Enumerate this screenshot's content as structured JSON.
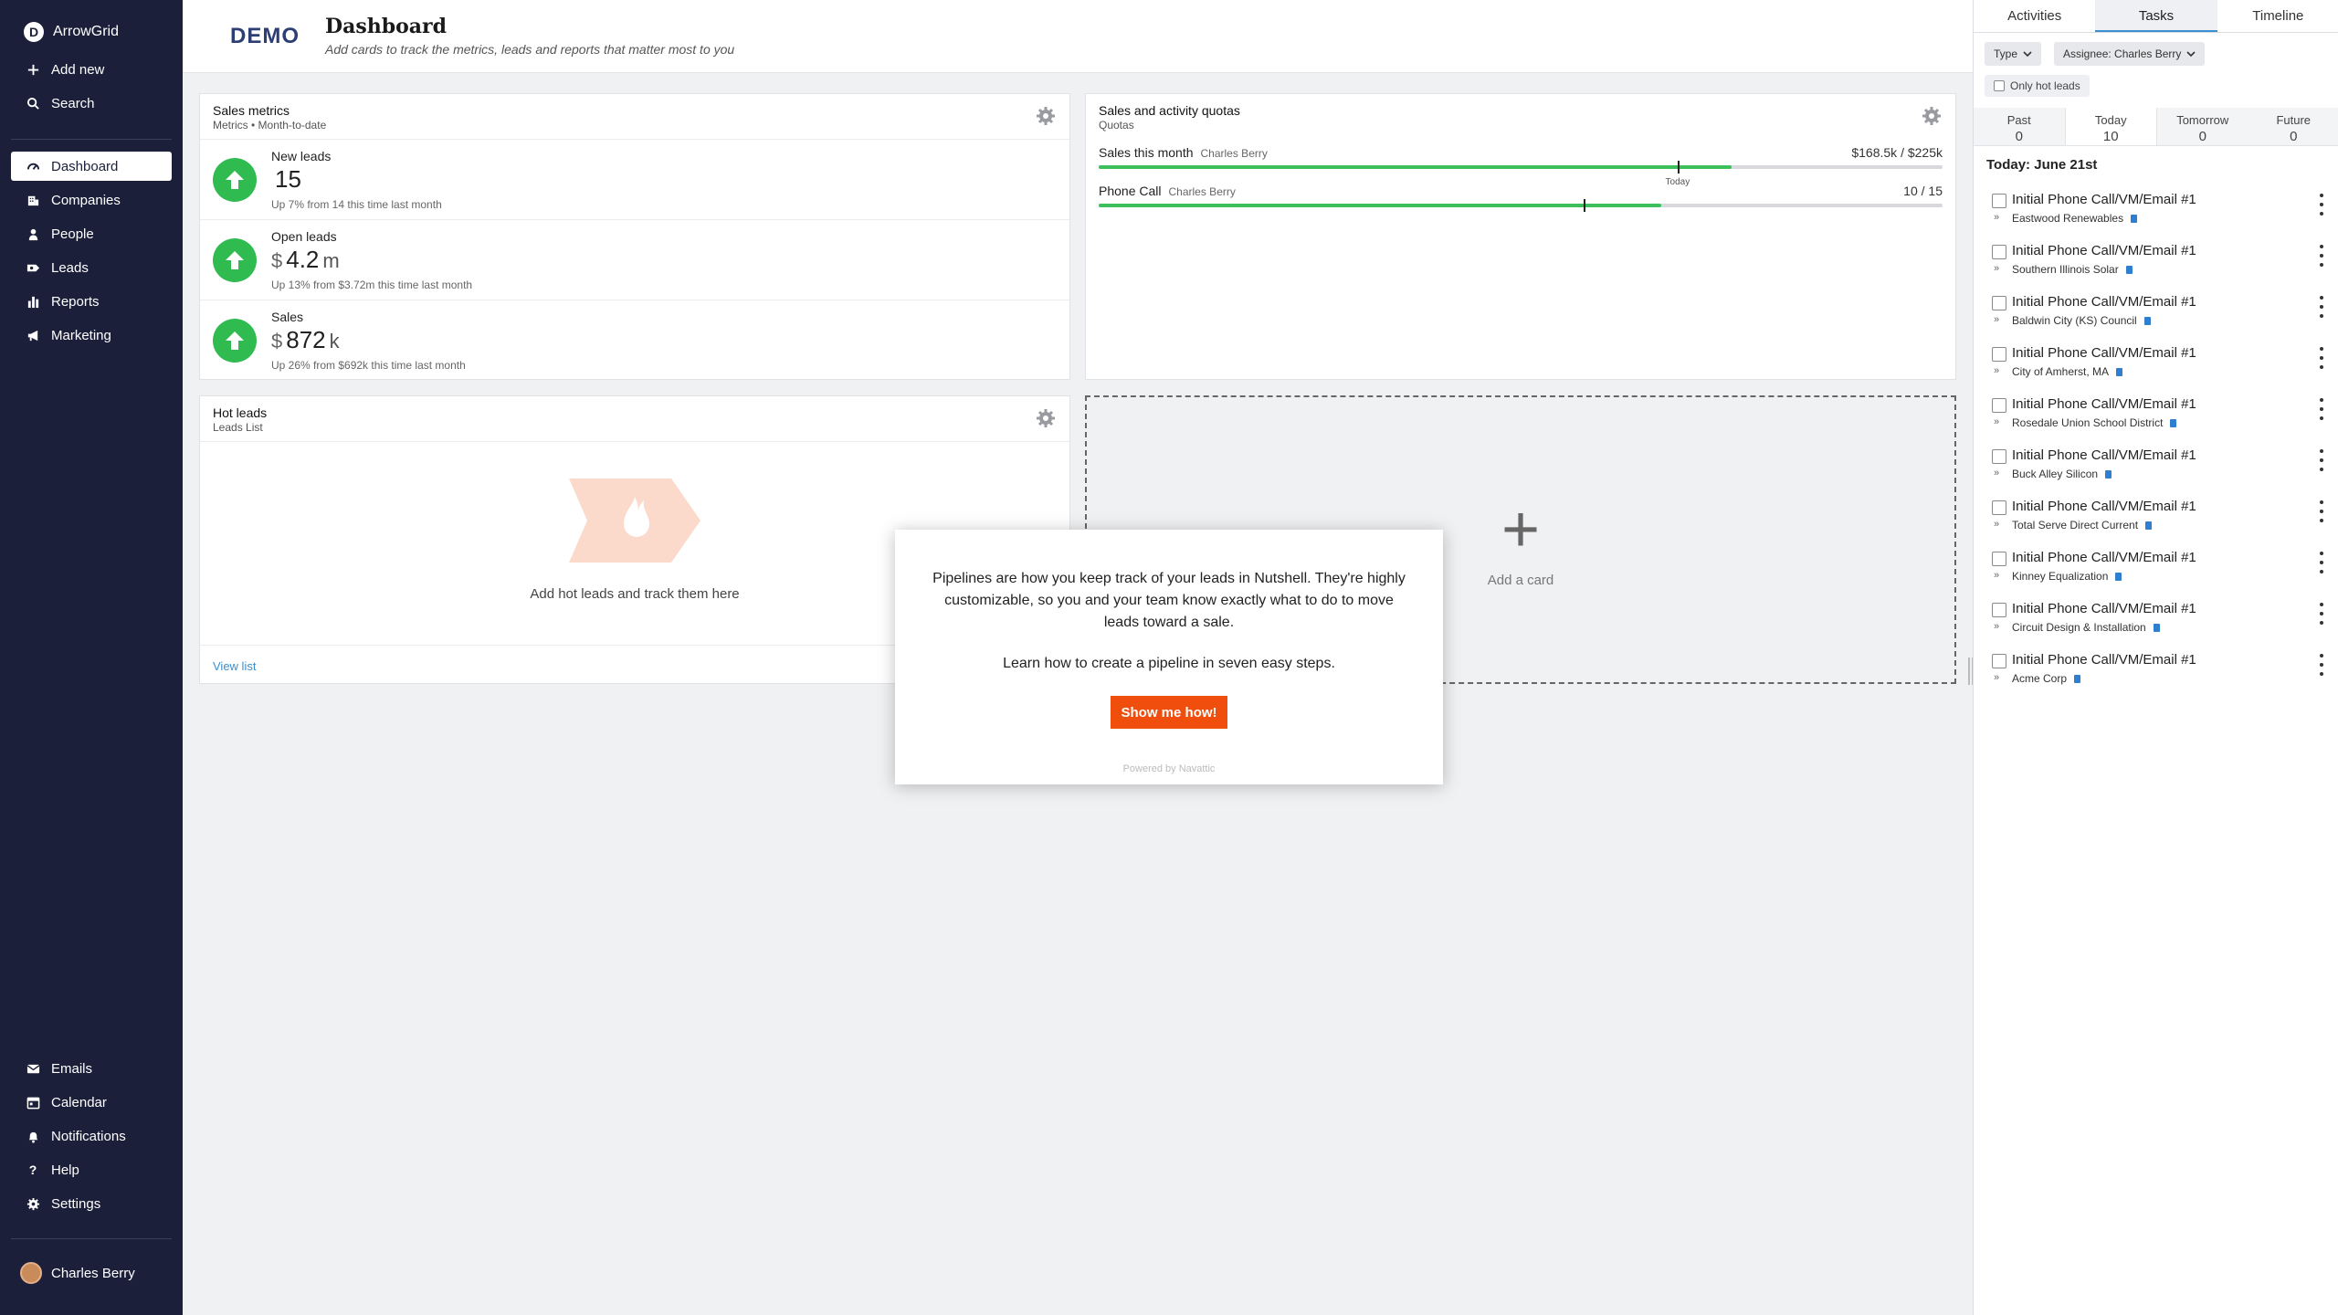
{
  "app": {
    "name": "ArrowGrid",
    "logo_letter": "D"
  },
  "sidebar": {
    "top_items": [
      {
        "label": "Add new",
        "icon": "plus-icon"
      },
      {
        "label": "Search",
        "icon": "search-icon"
      }
    ],
    "main_items": [
      {
        "label": "Dashboard",
        "icon": "dashboard-icon",
        "active": true
      },
      {
        "label": "Companies",
        "icon": "building-icon"
      },
      {
        "label": "People",
        "icon": "person-icon"
      },
      {
        "label": "Leads",
        "icon": "lead-icon"
      },
      {
        "label": "Reports",
        "icon": "bar-chart-icon"
      },
      {
        "label": "Marketing",
        "icon": "megaphone-icon"
      }
    ],
    "bottom_items": [
      {
        "label": "Emails",
        "icon": "mail-icon"
      },
      {
        "label": "Calendar",
        "icon": "calendar-icon"
      },
      {
        "label": "Notifications",
        "icon": "bell-icon"
      },
      {
        "label": "Help",
        "icon": "question-icon"
      },
      {
        "label": "Settings",
        "icon": "gear-icon"
      }
    ],
    "user": "Charles Berry"
  },
  "header": {
    "demo": "DEMO",
    "title": "Dashboard",
    "subtitle": "Add cards to track the metrics, leads and reports that matter most to you"
  },
  "sales_metrics": {
    "title": "Sales metrics",
    "subtitle": "Metrics • Month-to-date",
    "metrics": [
      {
        "label": "New leads",
        "currency": "",
        "value": "15",
        "unit": "",
        "note": "Up 7% from 14 this time last month"
      },
      {
        "label": "Open leads",
        "currency": "$",
        "value": "4.2",
        "unit": "m",
        "note": "Up 13% from $3.72m this time last month"
      },
      {
        "label": "Sales",
        "currency": "$",
        "value": "872",
        "unit": "k",
        "note": "Up 26% from $692k this time last month"
      }
    ]
  },
  "quotas": {
    "title": "Sales and activity quotas",
    "subtitle": "Quotas",
    "today_label": "Today",
    "rows": [
      {
        "label": "Sales this month",
        "owner": "Charles Berry",
        "value": "$168.5k / $225k",
        "progress": 0.75,
        "today": 0.686
      },
      {
        "label": "Phone Call",
        "owner": "Charles Berry",
        "value": "10 / 15",
        "progress": 0.667,
        "today": 0.575
      }
    ]
  },
  "hot_leads": {
    "title": "Hot leads",
    "subtitle": "Leads List",
    "empty_text": "Add hot leads and track them here",
    "view_list": "View list"
  },
  "add_card": {
    "label": "Add a card",
    "plus": "+"
  },
  "modal": {
    "text1": "Pipelines are how you keep track of your leads in Nutshell. They're highly customizable, so you and your team know exactly what to do to move leads toward a sale.",
    "text2": "Learn how to create a pipeline in seven easy steps.",
    "button": "Show me how!",
    "powered": "Powered by Navattic"
  },
  "right_panel": {
    "tabs": [
      "Activities",
      "Tasks",
      "Timeline"
    ],
    "active_tab": "Tasks",
    "filters": {
      "type": "Type",
      "assignee": "Assignee: Charles Berry"
    },
    "hot_only": "Only hot leads",
    "periods": [
      {
        "label": "Past",
        "count": "0"
      },
      {
        "label": "Today",
        "count": "10"
      },
      {
        "label": "Tomorrow",
        "count": "0"
      },
      {
        "label": "Future",
        "count": "0"
      }
    ],
    "today_heading": "Today: June 21st",
    "tasks": [
      {
        "title": "Initial Phone Call/VM/Email #1",
        "company": "Eastwood Renewables"
      },
      {
        "title": "Initial Phone Call/VM/Email #1",
        "company": "Southern Illinois Solar"
      },
      {
        "title": "Initial Phone Call/VM/Email #1",
        "company": "Baldwin City (KS) Council"
      },
      {
        "title": "Initial Phone Call/VM/Email #1",
        "company": "City of Amherst, MA"
      },
      {
        "title": "Initial Phone Call/VM/Email #1",
        "company": "Rosedale Union School District"
      },
      {
        "title": "Initial Phone Call/VM/Email #1",
        "company": "Buck Alley Silicon"
      },
      {
        "title": "Initial Phone Call/VM/Email #1",
        "company": "Total Serve Direct Current"
      },
      {
        "title": "Initial Phone Call/VM/Email #1",
        "company": "Kinney Equalization"
      },
      {
        "title": "Initial Phone Call/VM/Email #1",
        "company": "Circuit Design & Installation"
      },
      {
        "title": "Initial Phone Call/VM/Email #1",
        "company": "Acme Corp"
      }
    ]
  },
  "colors": {
    "sidebar": "#1b1f3a",
    "accent_green": "#2fbb4f",
    "cta": "#f04e0d",
    "link": "#3a8fd0"
  }
}
